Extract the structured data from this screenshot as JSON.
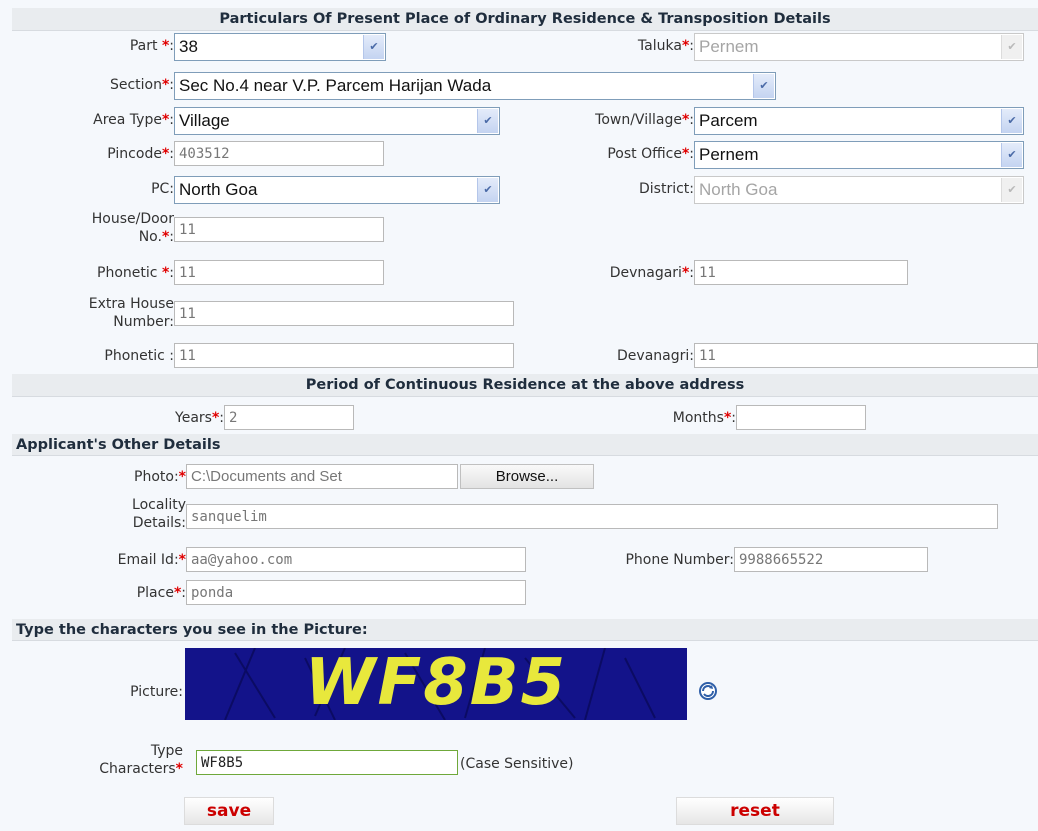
{
  "sections": {
    "residence_header": "Particulars Of Present Place of Ordinary Residence & Transposition Details",
    "period_header": "Period of Continuous Residence at the above address",
    "other_header": "Applicant's Other Details",
    "captcha_header": "Type the characters you see in the Picture:"
  },
  "req_mark": "*",
  "colon": ":",
  "labels": {
    "part": "Part ",
    "taluka": "Taluka",
    "section": "Section",
    "area_type": "Area Type",
    "town_village": "Town/Village",
    "pincode": "Pincode",
    "post_office": "Post Office",
    "pc": "PC",
    "district": "District",
    "house_door_1": "House/Door",
    "house_door_2": "No.",
    "phonetic1": "Phonetic ",
    "devnagari": "Devnagari",
    "extra_house_1": "Extra House",
    "extra_house_2": "Number",
    "phonetic2": "Phonetic ",
    "devanagri": "Devanagri",
    "years": "Years",
    "months": "Months",
    "photo": "Photo",
    "locality_1": "Locality",
    "locality_2": "Details",
    "email": "Email Id",
    "phone": "Phone Number",
    "place": "Place",
    "picture": "Picture",
    "type_chars_1": "Type",
    "type_chars_2": "Characters",
    "case_sensitive": "(Case Sensitive)"
  },
  "values": {
    "part": "38",
    "taluka": "Pernem",
    "section": "Sec No.4 near V.P. Parcem Harijan Wada",
    "area_type": "Village",
    "town_village": "Parcem",
    "pincode": "403512",
    "post_office": "Pernem",
    "pc": "North Goa",
    "district": "North Goa",
    "house_no": "11",
    "phonetic1": "11",
    "devnagari": "11",
    "extra_house": "11",
    "phonetic2": "11",
    "devanagri": "11",
    "years": "2",
    "months": "",
    "photo": "C:\\Documents and Set",
    "locality": "sanquelim",
    "email": "aa@yahoo.com",
    "phone": "9988665522",
    "place": "ponda",
    "captcha_text": "WF8B5",
    "typed_chars": "WF8B5"
  },
  "buttons": {
    "browse": "Browse...",
    "save": "save",
    "reset": "reset"
  },
  "icons": {
    "dropdown": "chevron-down-icon",
    "refresh": "refresh-icon"
  },
  "colors": {
    "required": "#e00000",
    "action_text": "#cc0000",
    "captcha_bg": "#13138a",
    "captcha_text": "#e8e83c"
  }
}
